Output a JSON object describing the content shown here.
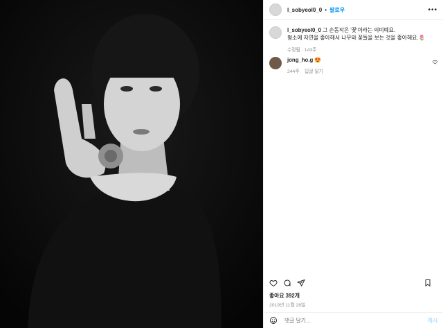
{
  "post": {
    "username": "l_sobyeol0_0",
    "follow_label": "팔로우",
    "separator": "•",
    "more_icon": "more-icon",
    "caption": {
      "username": "l_sobyeol0_0",
      "line1": "그 손동작은 '꽃'이라는 의미예요.",
      "line2": "평소에 자연을 좋아해서 나무와 꽃들을 보는 것을 좋아해요.🌷",
      "meta": "수정됨 · 143주"
    },
    "comment": {
      "username": "jong_ho.g",
      "text": "😍",
      "likes": "244주",
      "reply_label": "답글 달기"
    },
    "likes_label": "좋아요 392개",
    "date": "2019년 11월 28일",
    "input_placeholder": "댓글 달기...",
    "post_label": "게시",
    "colors": {
      "accent": "#0095f6",
      "muted": "#8e8e8e",
      "text": "#262626"
    }
  }
}
